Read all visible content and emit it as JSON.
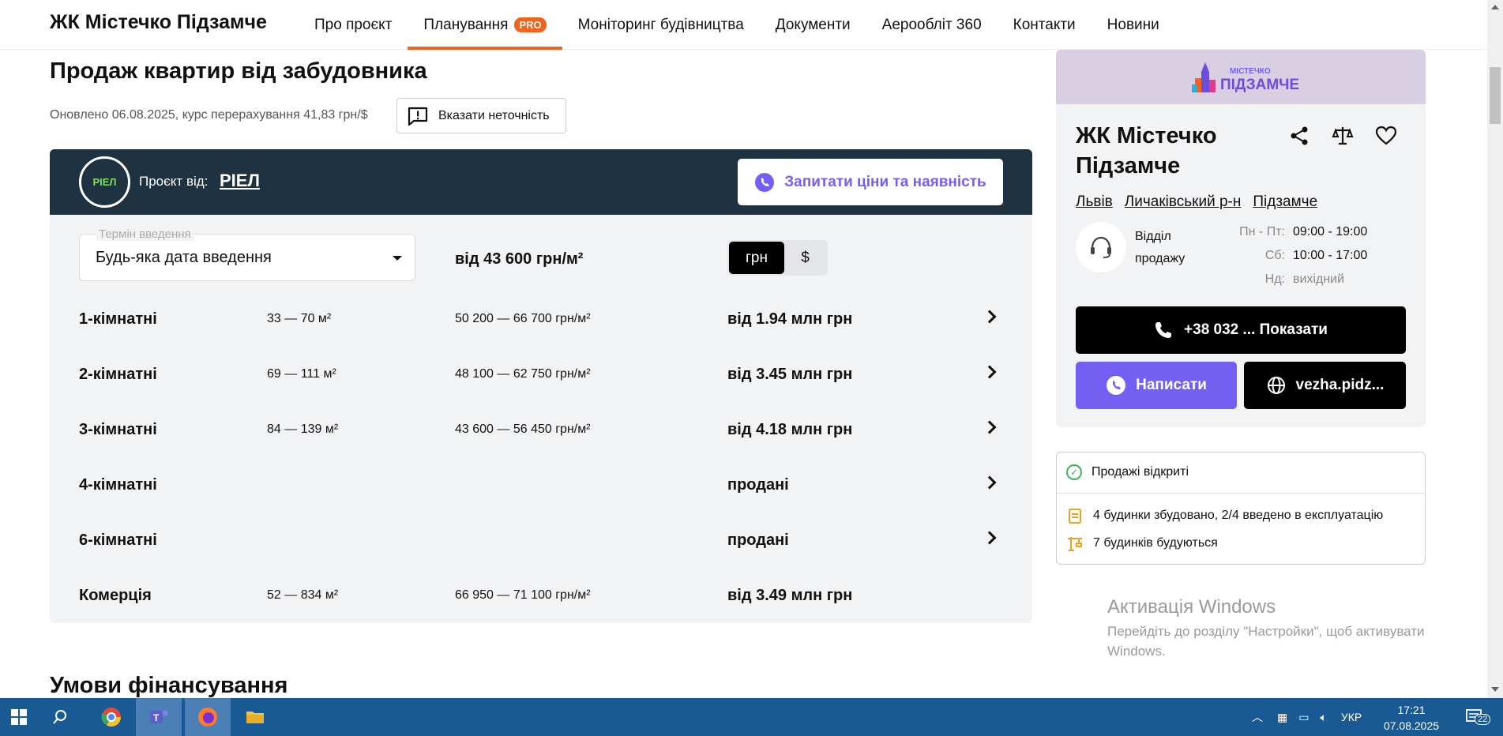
{
  "nav": {
    "brand": "ЖК Містечко Підзамче",
    "links": [
      "Про проєкт",
      "Планування",
      "Моніторинг будівництва",
      "Документи",
      "Аерооблiт 360",
      "Контакти",
      "Новини"
    ],
    "pro_badge": "PRO",
    "active_index": 1
  },
  "main": {
    "title": "Продаж квартир від забудовника",
    "updated": "Оновлено 06.08.2025, курс перерахування 41,83 грн/$",
    "report_label": "Вказати неточність",
    "panel": {
      "logo_text": "РІЕЛ",
      "project_by_label": "Проєкт від:",
      "developer": "РІЕЛ",
      "ask_label": "Запитати ціни та наявність",
      "term_label": "Термін введення",
      "term_value": "Будь-яка дата введення",
      "from_price": "від 43 600 грн/м²",
      "currency_uah": "грн",
      "currency_usd": "$",
      "rows": [
        {
          "type": "1-кімнатні",
          "area": "33 — 70 м²",
          "price_m2": "50 200 — 66 700 грн/м²",
          "total": "від 1.94 млн грн"
        },
        {
          "type": "2-кімнатні",
          "area": "69 — 111 м²",
          "price_m2": "48 100 — 62 750 грн/м²",
          "total": "від 3.45 млн грн"
        },
        {
          "type": "3-кімнатні",
          "area": "84 — 139 м²",
          "price_m2": "43 600 — 56 450 грн/м²",
          "total": "від 4.18 млн грн"
        },
        {
          "type": "4-кімнатні",
          "area": "",
          "price_m2": "",
          "total": "продані"
        },
        {
          "type": "6-кімнатні",
          "area": "",
          "price_m2": "",
          "total": "продані"
        },
        {
          "type": "Комерція",
          "area": "52 — 834 м²",
          "price_m2": "66 950 — 71 100 грн/м²",
          "total": "від 3.49 млн грн"
        }
      ]
    },
    "section_title": "Умови фінансування"
  },
  "sidebar": {
    "logo_small": "МІСТЕЧКО",
    "logo_big": "ПІДЗАМЧЕ",
    "title": "ЖК Містечко Підзамче",
    "locations": [
      "Львів",
      "Личаківський р-н",
      "Підзамче"
    ],
    "sales_dept": "Відділ продажу",
    "hours": [
      {
        "day": "Пн - Пт:",
        "time": "09:00 - 19:00"
      },
      {
        "day": "Сб:",
        "time": "10:00 - 17:00"
      },
      {
        "day": "Нд:",
        "time": "вихідний"
      }
    ],
    "phone_label": "+38 032 ... Показати",
    "write_label": "Написати",
    "site_label": "vezha.pidz...",
    "status": {
      "sales_open": "Продажі відкриті",
      "built": "4 будинки збудовано, 2/4 введено в експлуатацію",
      "building": "7 будинків будуються"
    }
  },
  "windows": {
    "activation_title": "Активація Windows",
    "activation_text": "Перейдіть до розділу \"Настройки\", щоб активувати Windows.",
    "lang": "УКР",
    "time": "17:21",
    "date": "07.08.2025",
    "notifications": "22"
  },
  "colors": {
    "accent_orange": "#f0641e",
    "viber_purple": "#7360f2",
    "panel_dark": "#1e3241",
    "taskbar": "#1a5a94"
  }
}
